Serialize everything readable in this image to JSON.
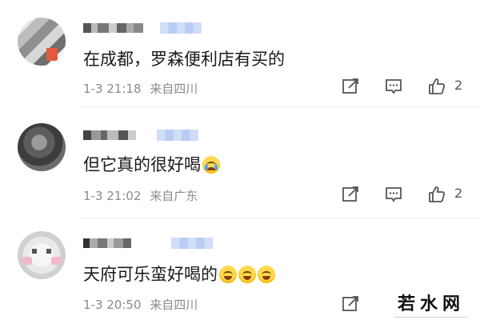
{
  "comments": [
    {
      "text": "在成都，罗森便利店有买的",
      "time": "1-3 21:18",
      "location": "来自四川",
      "likes": "2",
      "emojis": []
    },
    {
      "text": "但它真的很好喝",
      "time": "1-3 21:02",
      "location": "来自广东",
      "likes": "2",
      "emojis": [
        "crying-face"
      ]
    },
    {
      "text": "天府可乐蛮好喝的",
      "time": "1-3 20:50",
      "location": "来自四川",
      "likes": "",
      "emojis": [
        "grinning-face",
        "grinning-face",
        "grinning-face"
      ]
    }
  ],
  "watermark": {
    "text": "若水网"
  },
  "icons": {
    "share": "share-icon",
    "reply": "comment-icon",
    "like": "thumbs-up-icon"
  },
  "colors": {
    "badge": "#b9cdf4",
    "meta": "#8a8a8a",
    "icon": "#555555"
  }
}
